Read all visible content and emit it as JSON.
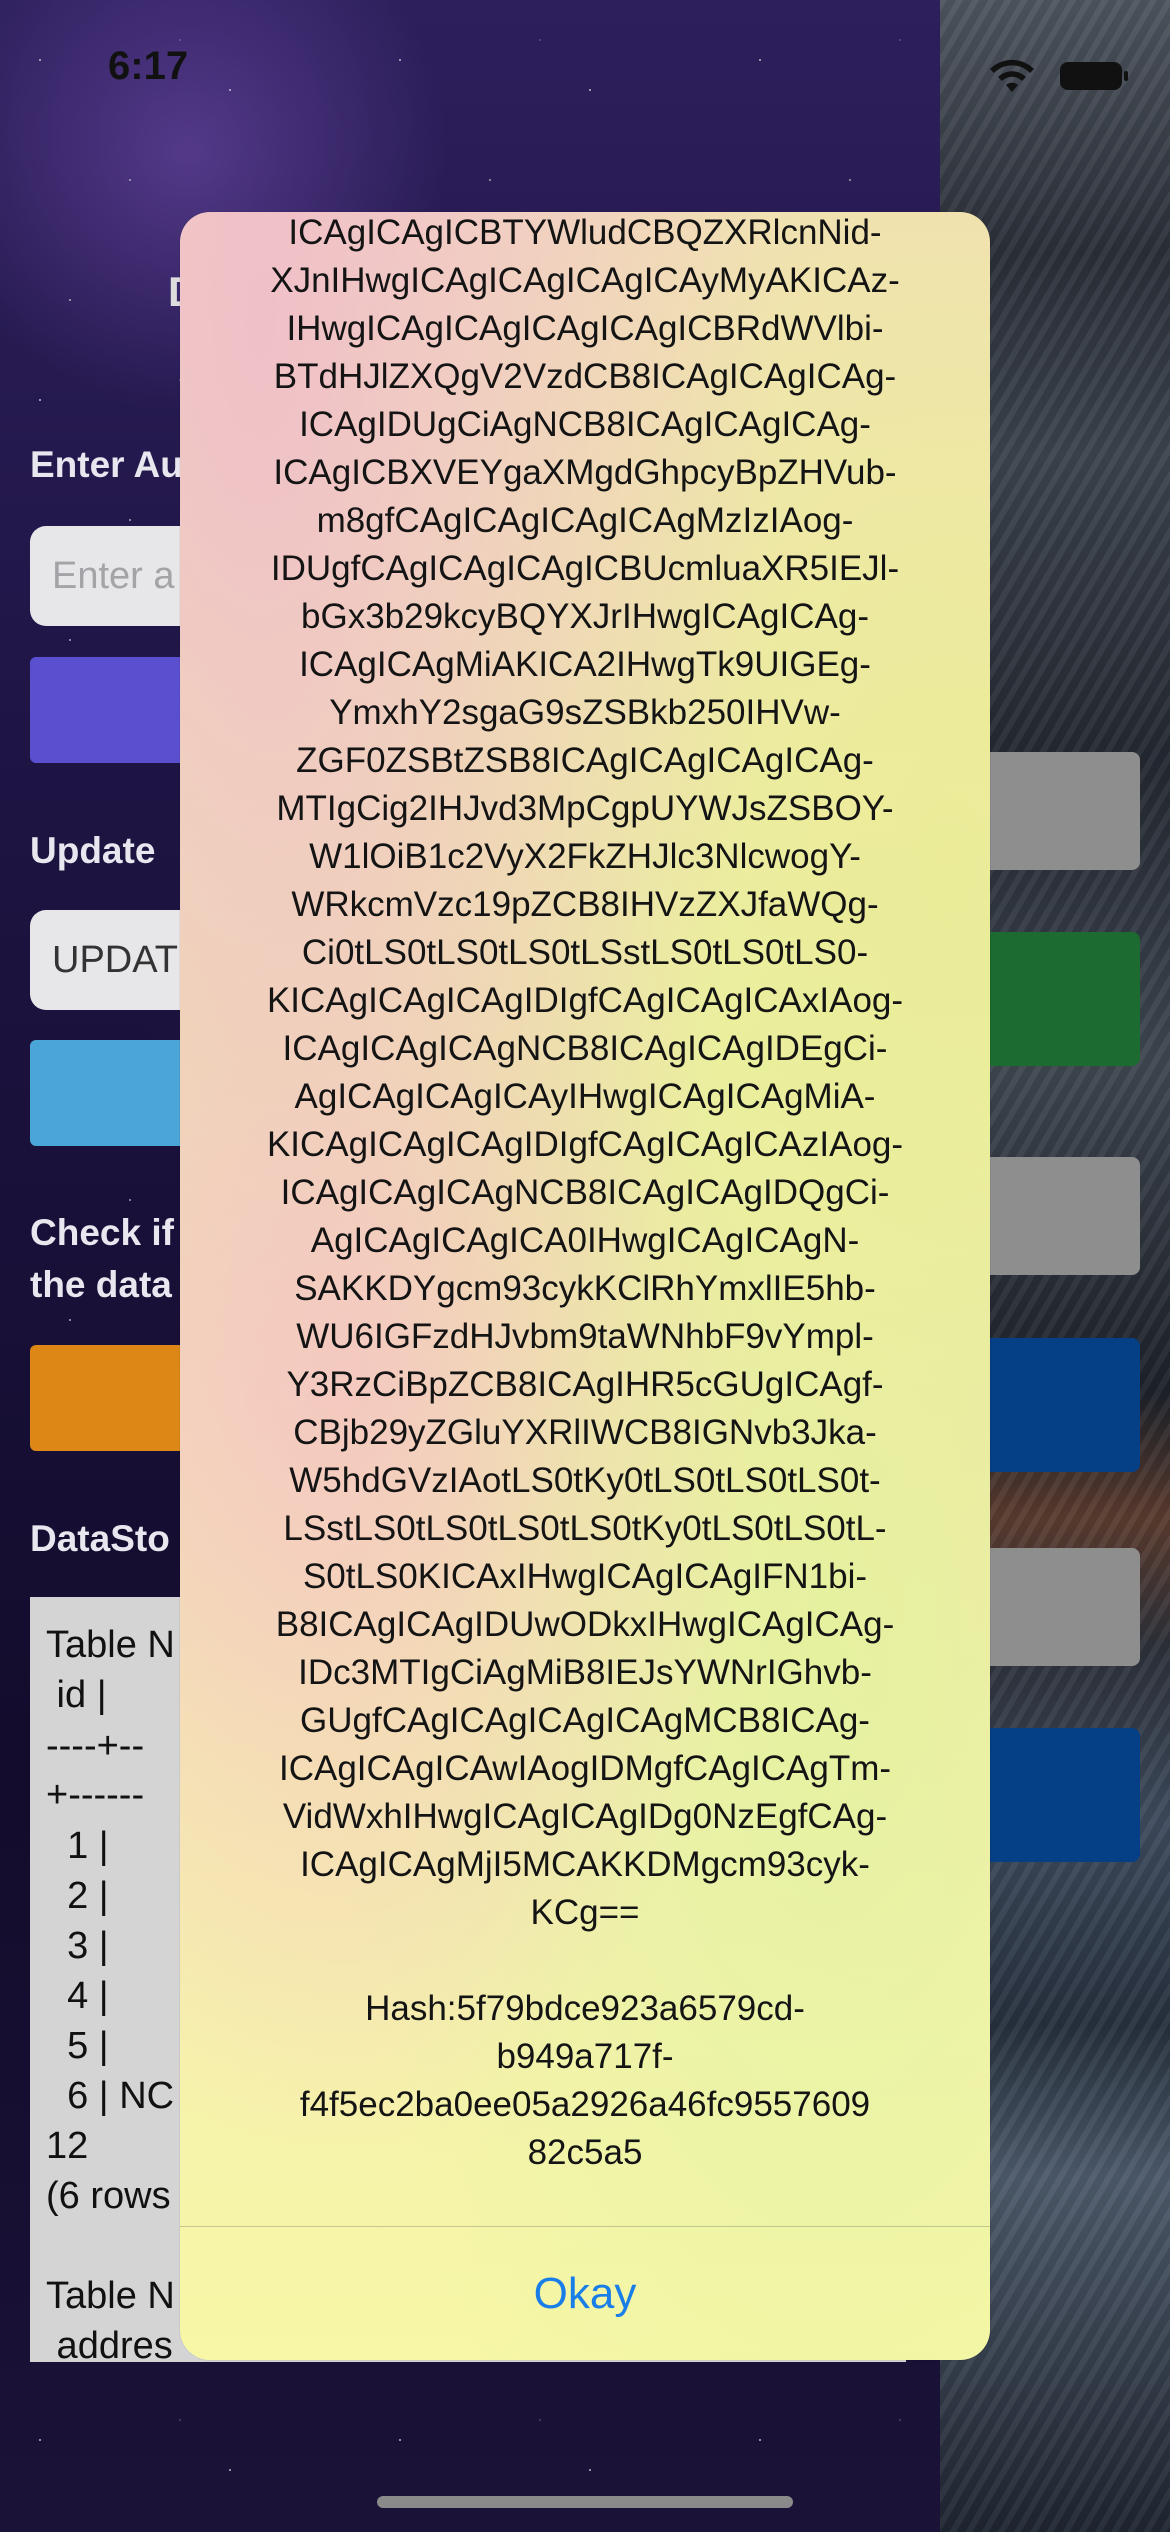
{
  "status_bar": {
    "time": "6:17"
  },
  "screen": {
    "title_fragment": "D",
    "auth_label": "Enter Au",
    "auth_placeholder": "Enter a",
    "update_label": "Update",
    "update_value": "UPDAT",
    "check_label_line1": "Check if",
    "check_label_line2": "the data",
    "datastore_label": "DataSto",
    "data_lines": [
      "Table N",
      " id |",
      "----+--",
      "+------",
      "  1 |",
      "  2 |",
      "  3 |",
      "  4 |",
      "  5 |",
      "  6 | NC",
      "12",
      "(6 rows",
      "",
      "Table N",
      " addres"
    ]
  },
  "colors": {
    "button_purple": "#5a4fcf",
    "button_blue": "#4aa6d6",
    "button_orange": "#dd8717",
    "right_gray": "#8e8e8e",
    "right_green": "#1c6b30",
    "right_navy": "#053f86"
  },
  "alert": {
    "message_lines": [
      "ICAgICAgICBTYWludCBQZXRlcnNid-",
      "XJnIHwgICAgICAgICAgICAyMyAKICAz-",
      "IHwgICAgICAgICAgICAgICBRdWVlbi-",
      "BTdHJlZXQgV2VzdCB8ICAgICAgICAg-",
      "ICAgIDUgCiAgNCB8ICAgICAgICAg-",
      "ICAgICBXVEYgaXMgdGhpcyBpZHVub-",
      "m8gfCAgICAgICAgICAgMzIzIAog-",
      "IDUgfCAgICAgICAgICBUcmluaXR5IEJl-",
      "bGx3b29kcyBQYXJrIHwgICAgICAg-",
      "ICAgICAgMiAKICA2IHwgTk9UIGEg-",
      "YmxhY2sgaG9sZSBkb250IHVw-",
      "ZGF0ZSBtZSB8ICAgICAgICAgICAg-",
      "MTIgCig2IHJvd3MpCgpUYWJsZSBOY-",
      "W1lOiB1c2VyX2FkZHJlc3NlcwogY-",
      "WRkcmVzc19pZCB8IHVzZXJfaWQg-",
      "Ci0tLS0tLS0tLS0tLSstLS0tLS0tLS0-",
      "KICAgICAgICAgIDIgfCAgICAgICAxIAog-",
      "ICAgICAgICAgNCB8ICAgICAgIDEgCi-",
      "AgICAgICAgICAyIHwgICAgICAgMiA-",
      "KICAgICAgICAgIDIgfCAgICAgICAzIAog-",
      "ICAgICAgICAgNCB8ICAgICAgIDQgCi-",
      "AgICAgICAgICA0IHwgICAgICAgN-",
      "SAKKDYgcm93cykKClRhYmxlIE5hb-",
      "WU6IGFzdHJvbm9taWNhbF9vYmpl-",
      "Y3RzCiBpZCB8ICAgIHR5cGUgICAgf-",
      "CBjb29yZGluYXRlIWCB8IGNvb3Jka-",
      "W5hdGVzIAotLS0tKy0tLS0tLS0tLS0t-",
      "LSstLS0tLS0tLS0tLS0tKy0tLS0tLS0tL-",
      "S0tLS0KICAxIHwgICAgICAgIFN1bi-",
      "B8ICAgICAgIDUwODkxIHwgICAgICAg-",
      "IDc3MTIgCiAgMiB8IEJsYWNrIGhvb-",
      "GUgfCAgICAgICAgICAgMCB8ICAg-",
      "ICAgICAgICAwIAogIDMgfCAgICAgTm-",
      "VidWxhIHwgICAgICAgIDg0NzEgfCAg-",
      "ICAgICAgMjI5MCAKKDMgcm93cyk-",
      "KCg=="
    ],
    "hash_lines": [
      "Hash:5f79bdce923a6579cd-",
      "b949a717f-",
      "f4f5ec2ba0ee05a2926a46fc9557609",
      "82c5a5"
    ],
    "button_label": "Okay"
  }
}
